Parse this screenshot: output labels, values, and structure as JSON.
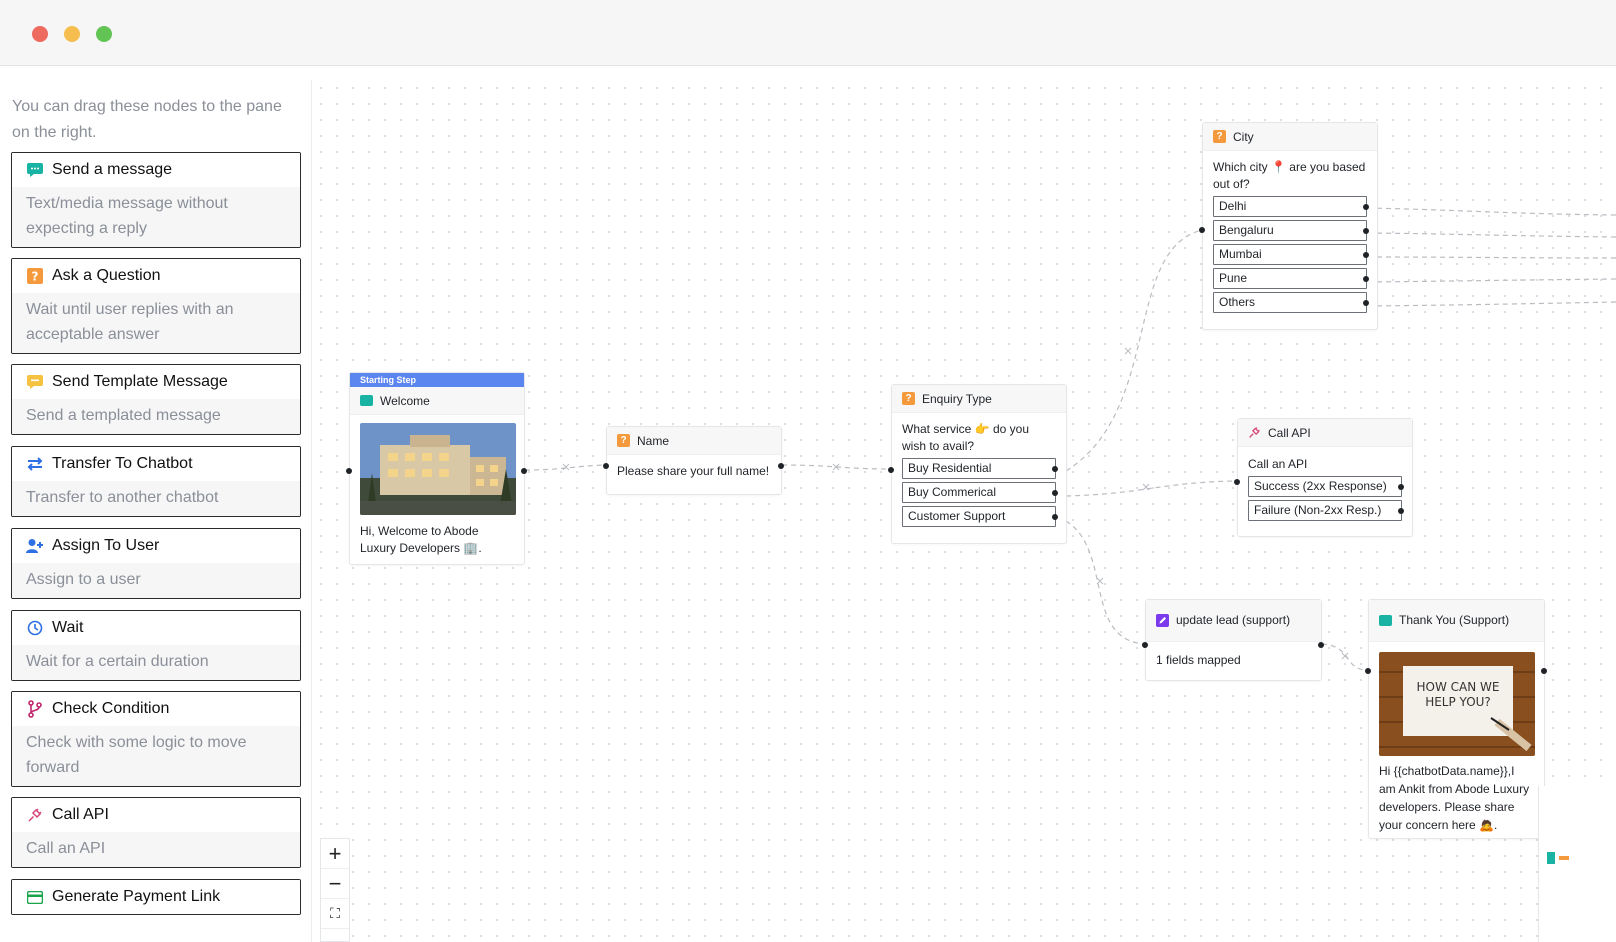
{
  "sidebar": {
    "hint": "You can drag these nodes to the pane on the right.",
    "items": [
      {
        "title": "Send a message",
        "desc": "Text/media message without expecting a reply",
        "icon": "message-icon"
      },
      {
        "title": "Ask a Question",
        "desc": "Wait until user replies with an acceptable answer",
        "icon": "question-icon"
      },
      {
        "title": "Send Template Message",
        "desc": "Send a templated message",
        "icon": "template-icon"
      },
      {
        "title": "Transfer To Chatbot",
        "desc": "Transfer to another chatbot",
        "icon": "transfer-icon"
      },
      {
        "title": "Assign To User",
        "desc": "Assign to a user",
        "icon": "user-plus-icon"
      },
      {
        "title": "Wait",
        "desc": "Wait for a certain duration",
        "icon": "clock-icon"
      },
      {
        "title": "Check Condition",
        "desc": "Check with some logic to move forward",
        "icon": "branch-icon"
      },
      {
        "title": "Call API",
        "desc": "Call an API",
        "icon": "plug-icon"
      },
      {
        "title": "Generate Payment Link",
        "desc": "",
        "icon": "card-icon"
      }
    ]
  },
  "flow": {
    "welcome": {
      "badge": "Starting Step",
      "title": "Welcome",
      "text": "Hi, Welcome to Abode Luxury Developers 🏢."
    },
    "name": {
      "title": "Name",
      "text": "Please share your full name!"
    },
    "enquiry": {
      "title": "Enquiry Type",
      "text": "What service 👉 do you wish to avail?",
      "options": [
        "Buy Residential",
        "Buy Commerical",
        "Customer Support"
      ]
    },
    "city": {
      "title": "City",
      "text": "Which city 📍 are you based out of?",
      "options": [
        "Delhi",
        "Bengaluru",
        "Mumbai",
        "Pune",
        "Others"
      ]
    },
    "callapi": {
      "title": "Call API",
      "text": "Call an API",
      "options": [
        "Success (2xx Response)",
        "Failure (Non-2xx Resp.)"
      ]
    },
    "updatelead": {
      "title": "update lead (support)",
      "text": "1 fields mapped"
    },
    "thankyou": {
      "title": "Thank You (Support)",
      "image_text": "HOW CAN WE HELP YOU?",
      "text": "Hi {{chatbotData.name}},I am Ankit from Abode Luxury developers. Please share your concern here 🙇."
    }
  },
  "zoom": {
    "plus": "+",
    "minus": "−",
    "fit": "⛶"
  },
  "colors": {
    "accent_blue": "#5b86f0",
    "question_orange": "#f59a3c",
    "message_teal": "#18b3a3",
    "update_purple": "#7c3aed"
  }
}
